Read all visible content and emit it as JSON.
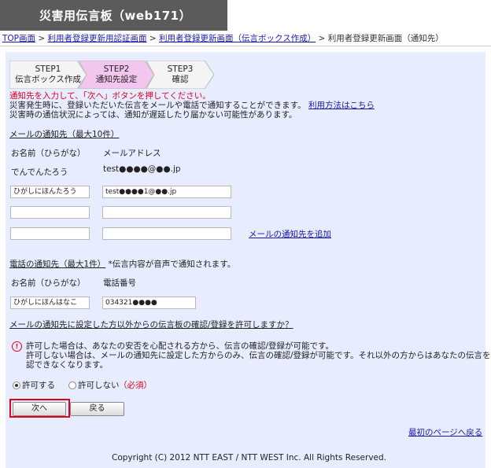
{
  "header": {
    "title": "災害用伝言板（web171）"
  },
  "breadcrumb": {
    "items": [
      "TOP画面",
      "利用者登録更新用認証画面",
      "利用者登録更新画面（伝言ボックス作成）"
    ],
    "current": "利用者登録更新画面（通知先）",
    "sep": ">"
  },
  "steps": [
    {
      "num": "STEP1",
      "label": "伝言ボックス作成"
    },
    {
      "num": "STEP2",
      "label": "通知先設定"
    },
    {
      "num": "STEP3",
      "label": "確認"
    }
  ],
  "intro": {
    "instruction": "通知先を入力して、「次へ」ボタンを押してください。",
    "line1": "災害発生時に、登録いただいた伝言をメールや電話で通知することができます。",
    "usage_link": "利用方法はこちら",
    "line2": "災害時の通信状況によっては、通知が遅延したり届かない可能性があります。"
  },
  "mail": {
    "section_title": "メールの通知先（最大10件）",
    "col_name": "お名前（ひらがな）",
    "col_address": "メールアドレス",
    "example_name": "でんでんたろう",
    "example_address": "test●●●●@●●.jp",
    "rows": [
      {
        "name": "ひがしにほんたろう",
        "address": "test●●●●1@●●.jp"
      },
      {
        "name": "",
        "address": ""
      },
      {
        "name": "",
        "address": ""
      }
    ],
    "add_link": "メールの通知先を追加"
  },
  "phone": {
    "section_title": "電話の通知先（最大1件）",
    "note": "*伝言内容が音声で通知されます。",
    "col_name": "お名前（ひらがな）",
    "col_number": "電話番号",
    "name_value": "ひがしにほんはなこ",
    "number_value": "034321●●●●"
  },
  "permission": {
    "question": "メールの通知先に設定した方以外からの伝言板の確認/登録を許可しますか？",
    "warn_icon": "!",
    "info1": "許可した場合は、あなたの安否を心配される方から、伝言の確認/登録が可能です。",
    "info2": "許可しない場合は、メールの通知先に設定した方からのみ、伝言の確認/登録が可能です。それ以外の方からはあなたの伝言を確",
    "info3": "認できなくなります。",
    "options": [
      {
        "label": "許可する",
        "selected": true
      },
      {
        "label": "許可しない",
        "selected": false
      }
    ],
    "required": "（必須）"
  },
  "buttons": {
    "next": "次へ",
    "back": "戻る"
  },
  "back_to_top": "最初のページへ戻る",
  "footer": "Copyright (C) 2012 NTT EAST / NTT WEST Inc. All Rights Reserved.",
  "colors": {
    "accent_red": "#e0001b",
    "panel_bg": "#e8ecff",
    "link": "#1a1aa6",
    "active_step": "#f3c6f0"
  }
}
